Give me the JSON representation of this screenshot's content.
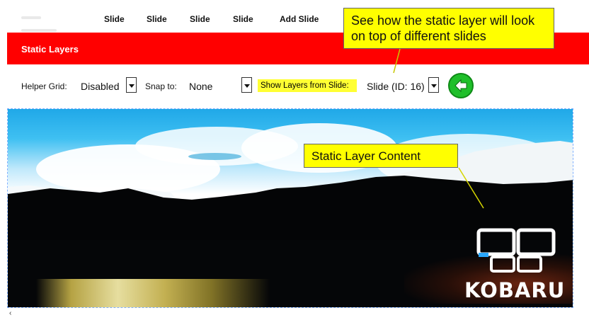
{
  "tabs": {
    "items": [
      "Slide",
      "Slide",
      "Slide",
      "Slide",
      "Add Slide"
    ]
  },
  "header": {
    "title": "Static Layers"
  },
  "toolbar": {
    "helper_grid_label": "Helper Grid:",
    "helper_grid_value": "Disabled",
    "snap_label": "Snap to:",
    "snap_value": "None",
    "show_layers_label": "Show Layers from Slide:",
    "show_layers_value": "Slide (ID: 16)"
  },
  "callouts": {
    "top": "See how the static layer will look on top of different slides",
    "stage": "Static Layer Content"
  },
  "logo": {
    "text": "KOBARU"
  },
  "colors": {
    "header_bar": "#ff0000",
    "callout": "#ffff00",
    "highlight": "#ffff33",
    "go_button": "#1fbf2a"
  },
  "icons": {
    "go_button": "arrow-left-icon",
    "dropdown": "chevron-down-icon"
  }
}
